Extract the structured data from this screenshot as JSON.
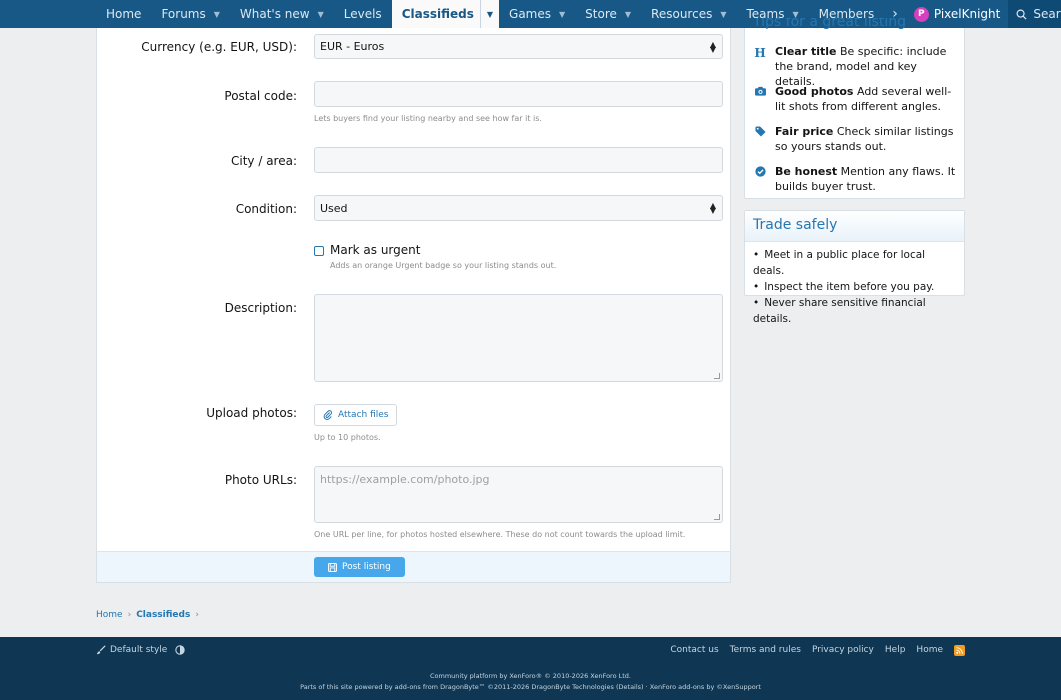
{
  "nav": {
    "items": [
      {
        "label": "Home",
        "caret": false
      },
      {
        "label": "Forums",
        "caret": true
      },
      {
        "label": "What's new",
        "caret": true
      },
      {
        "label": "Levels",
        "caret": false
      },
      {
        "label": "Classifieds",
        "caret": true,
        "active": true
      },
      {
        "label": "Games",
        "caret": true
      },
      {
        "label": "Store",
        "caret": true
      },
      {
        "label": "Resources",
        "caret": true
      },
      {
        "label": "Teams",
        "caret": true
      },
      {
        "label": "Members",
        "caret": false
      }
    ],
    "more": "›",
    "user": {
      "initial": "P",
      "name": "PixelKnight"
    },
    "search_label": "Search"
  },
  "form": {
    "currency": {
      "label": "Currency (e.g. EUR, USD):",
      "value": "EUR - Euros"
    },
    "postal": {
      "label": "Postal code:",
      "value": "",
      "hint": "Lets buyers find your listing nearby and see how far it is."
    },
    "city": {
      "label": "City / area:",
      "value": ""
    },
    "condition": {
      "label": "Condition:",
      "value": "Used"
    },
    "urgent": {
      "label": "Mark as urgent",
      "hint": "Adds an orange Urgent badge so your listing stands out.",
      "checked": false
    },
    "description": {
      "label": "Description:",
      "value": ""
    },
    "upload": {
      "label": "Upload photos:",
      "button": "Attach files",
      "hint": "Up to 10 photos."
    },
    "photo_urls": {
      "label": "Photo URLs:",
      "placeholder": "https://example.com/photo.jpg",
      "hint": "One URL per line, for photos hosted elsewhere. These do not count towards the upload limit."
    },
    "submit": "Post listing"
  },
  "sidebar": {
    "tips_title": "Tips for a great listing",
    "tips": [
      {
        "icon": "heading-icon",
        "title": "Clear title",
        "text": "Be specific: include the brand, model and key details."
      },
      {
        "icon": "camera-icon",
        "title": "Good photos",
        "text": "Add several well-lit shots from different angles."
      },
      {
        "icon": "tag-icon",
        "title": "Fair price",
        "text": "Check similar listings so yours stands out."
      },
      {
        "icon": "check-circle-icon",
        "title": "Be honest",
        "text": "Mention any flaws. It builds buyer trust."
      }
    ],
    "trade_title": "Trade safely",
    "trade_items": [
      "Meet in a public place for local deals.",
      "Inspect the item before you pay.",
      "Never share sensitive financial details."
    ]
  },
  "breadcrumb": {
    "home": "Home",
    "current": "Classifieds"
  },
  "footer": {
    "style": "Default style",
    "links": [
      "Contact us",
      "Terms and rules",
      "Privacy policy",
      "Help",
      "Home"
    ],
    "copyright": "Community platform by XenForo® © 2010-2026 XenForo Ltd.",
    "addons": "Parts of this site powered by add-ons from DragonByte™ ©2011-2026 DragonByte Technologies (Details) · XenForo add-ons by ©XenSupport"
  },
  "colors": {
    "nav_bg": "#185886",
    "accent": "#2577b1",
    "footer_bg": "#0f3652",
    "submit_bg": "#47a7eb",
    "avatar": "#d63fbd",
    "rss": "#f29c20"
  }
}
